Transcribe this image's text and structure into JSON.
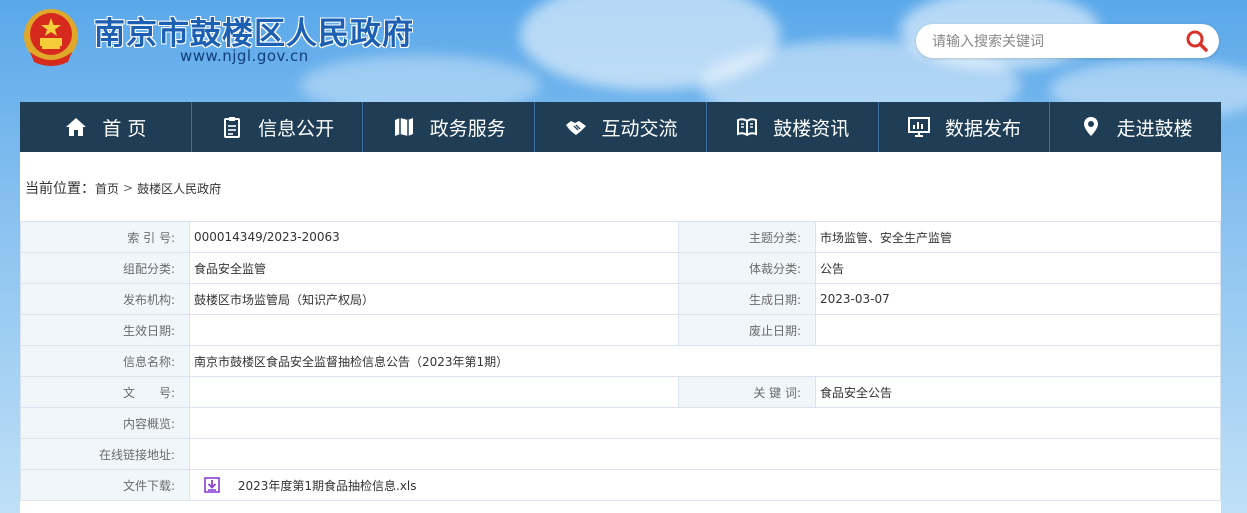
{
  "header": {
    "title": "南京市鼓楼区人民政府",
    "url": "www.njgl.gov.cn"
  },
  "search": {
    "placeholder": "请输入搜索关键词",
    "icon": "search-icon"
  },
  "nav": [
    {
      "label": "首 页",
      "icon": "home-icon"
    },
    {
      "label": "信息公开",
      "icon": "clipboard-icon"
    },
    {
      "label": "政务服务",
      "icon": "map-icon"
    },
    {
      "label": "互动交流",
      "icon": "handshake-icon"
    },
    {
      "label": "鼓楼资讯",
      "icon": "book-icon"
    },
    {
      "label": "数据发布",
      "icon": "monitor-chart-icon"
    },
    {
      "label": "走进鼓楼",
      "icon": "location-pin-icon"
    }
  ],
  "breadcrumb": {
    "label": "当前位置：",
    "items": [
      "首页",
      "鼓楼区人民政府"
    ],
    "separator": ">"
  },
  "meta": {
    "index_label": "索 引 号:",
    "index_value": "000014349/2023-20063",
    "topic_label": "主题分类:",
    "topic_value": "市场监管、安全生产监管",
    "org_cat_label": "组配分类:",
    "org_cat_value": "食品安全监管",
    "genre_label": "体裁分类:",
    "genre_value": "公告",
    "publisher_label": "发布机构:",
    "publisher_value": "鼓楼区市场监管局（知识产权局）",
    "created_label": "生成日期:",
    "created_value": "2023-03-07",
    "effective_label": "生效日期:",
    "effective_value": "",
    "expired_label": "废止日期:",
    "expired_value": "",
    "name_label": "信息名称:",
    "name_value": "南京市鼓楼区食品安全监督抽检信息公告（2023年第1期）",
    "docno_label": "文　　号:",
    "docno_value": "",
    "keywords_label": "关 键 词:",
    "keywords_value": "食品安全公告",
    "summary_label": "内容概览:",
    "summary_value": "",
    "link_label": "在线链接地址:",
    "link_value": "",
    "download_label": "文件下载:",
    "download_file": "2023年度第1期食品抽检信息.xls"
  },
  "colors": {
    "nav_bg": "#1f3e56",
    "title_blue": "#1d5fb3",
    "label_bg": "#f1f6fb",
    "search_icon": "#d9322b",
    "download_icon": "#8a3fd1"
  }
}
